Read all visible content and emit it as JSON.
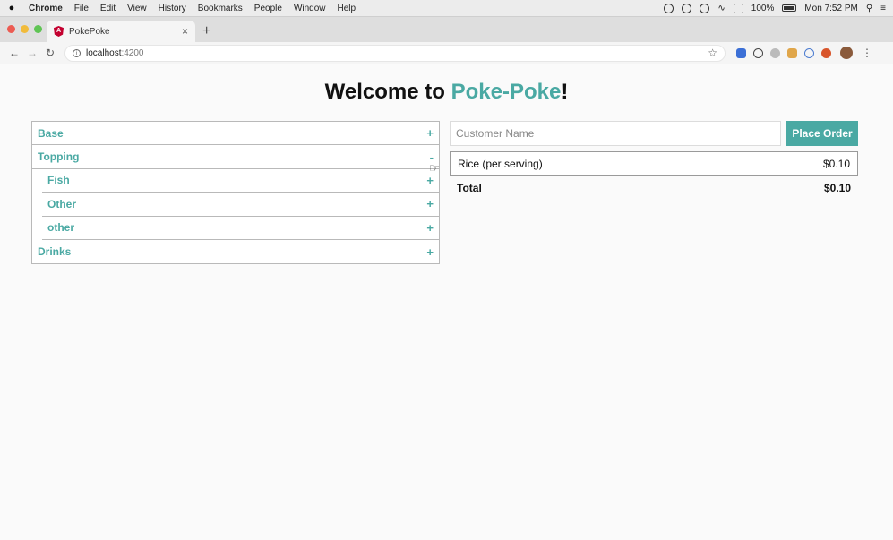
{
  "os_menubar": {
    "app": "Chrome",
    "items": [
      "File",
      "Edit",
      "View",
      "History",
      "Bookmarks",
      "People",
      "Window",
      "Help"
    ],
    "battery": "100%",
    "clock": "Mon 7:52 PM"
  },
  "browser": {
    "tab_title": "PokePoke",
    "url_host": "localhost",
    "url_port": ":4200"
  },
  "page": {
    "heading_prefix": "Welcome to ",
    "heading_brand": "Poke-Poke",
    "heading_suffix": "!"
  },
  "menu": {
    "base": {
      "label": "Base",
      "toggle": "+"
    },
    "topping": {
      "label": "Topping",
      "toggle": "-"
    },
    "topping_children": [
      {
        "label": "Fish",
        "toggle": "+"
      },
      {
        "label": "Other",
        "toggle": "+"
      },
      {
        "label": "other",
        "toggle": "+"
      }
    ],
    "drinks": {
      "label": "Drinks",
      "toggle": "+"
    }
  },
  "order": {
    "customer_placeholder": "Customer Name",
    "place_order_label": "Place Order",
    "items": [
      {
        "name": "Rice (per serving)",
        "price": "$0.10"
      }
    ],
    "total_label": "Total",
    "total_value": "$0.10"
  },
  "colors": {
    "accent": "#4aa9a3"
  }
}
